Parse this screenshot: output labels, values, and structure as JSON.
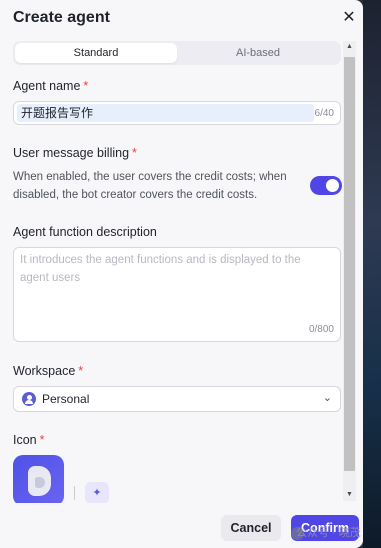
{
  "dialog": {
    "title": "Create agent",
    "close_glyph": "✕"
  },
  "tabs": [
    {
      "label": "Standard",
      "active": true
    },
    {
      "label": "AI-based",
      "active": false
    }
  ],
  "agent_name": {
    "label": "Agent name",
    "required_mark": "*",
    "value": "开题报告写作",
    "counter": "6/40"
  },
  "billing": {
    "label": "User message billing",
    "required_mark": "*",
    "help": "When enabled, the user covers the credit costs; when disabled, the bot creator covers the credit costs.",
    "enabled": true,
    "toggle_color": "#4f46e5"
  },
  "description": {
    "label": "Agent function description",
    "placeholder": "It introduces the agent functions and is displayed to the agent users",
    "counter": "0/800"
  },
  "workspace": {
    "label": "Workspace",
    "required_mark": "*",
    "selected": "Personal",
    "icon": "user-icon",
    "chevron": "⌄"
  },
  "icon_field": {
    "label": "Icon",
    "required_mark": "*",
    "generate_icon": "sparkle-icon",
    "generate_glyph": "✦"
  },
  "scrollbar": {
    "up_glyph": "▲",
    "down_glyph": "▼"
  },
  "footer": {
    "cancel_label": "Cancel",
    "confirm_label": "Confirm"
  },
  "watermark": {
    "text": "公众号 · 晓茂"
  },
  "colors": {
    "accent": "#4f46e5",
    "required": "#e3463f",
    "panel_bg": "#f7f7fa"
  }
}
